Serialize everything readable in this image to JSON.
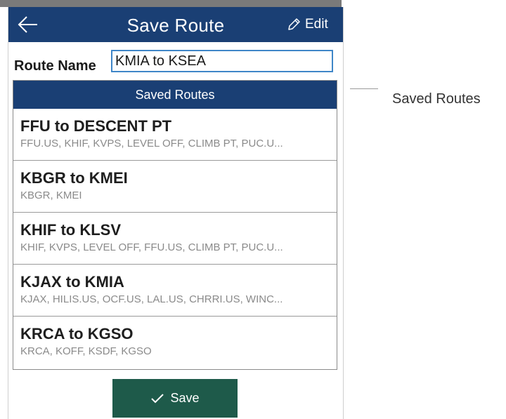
{
  "titlebar": {
    "title": "Save Route",
    "edit_label": "Edit"
  },
  "route_name": {
    "label": "Route Name",
    "value": "KMIA to KSEA"
  },
  "saved_routes": {
    "header": "Saved Routes",
    "items": [
      {
        "name": "FFU to DESCENT PT",
        "waypoints": "FFU.US, KHIF, KVPS, LEVEL OFF, CLIMB PT, PUC.U..."
      },
      {
        "name": "KBGR to KMEI",
        "waypoints": "KBGR, KMEI"
      },
      {
        "name": "KHIF to KLSV",
        "waypoints": "KHIF, KVPS, LEVEL OFF, FFU.US, CLIMB PT, PUC.U..."
      },
      {
        "name": "KJAX to KMIA",
        "waypoints": "KJAX, HILIS.US, OCF.US, LAL.US, CHRRI.US, WINC..."
      },
      {
        "name": "KRCA to KGSO",
        "waypoints": "KRCA, KOFF, KSDF, KGSO"
      }
    ]
  },
  "save_button": {
    "label": "Save"
  },
  "callout": {
    "label": "Saved Routes"
  },
  "icons": {
    "back": "arrow-left-icon",
    "edit": "pencil-icon",
    "save": "checkmark-icon"
  },
  "colors": {
    "header_bg": "#1a3f74",
    "save_bg": "#1e5a4a",
    "input_border": "#3f86c8"
  }
}
